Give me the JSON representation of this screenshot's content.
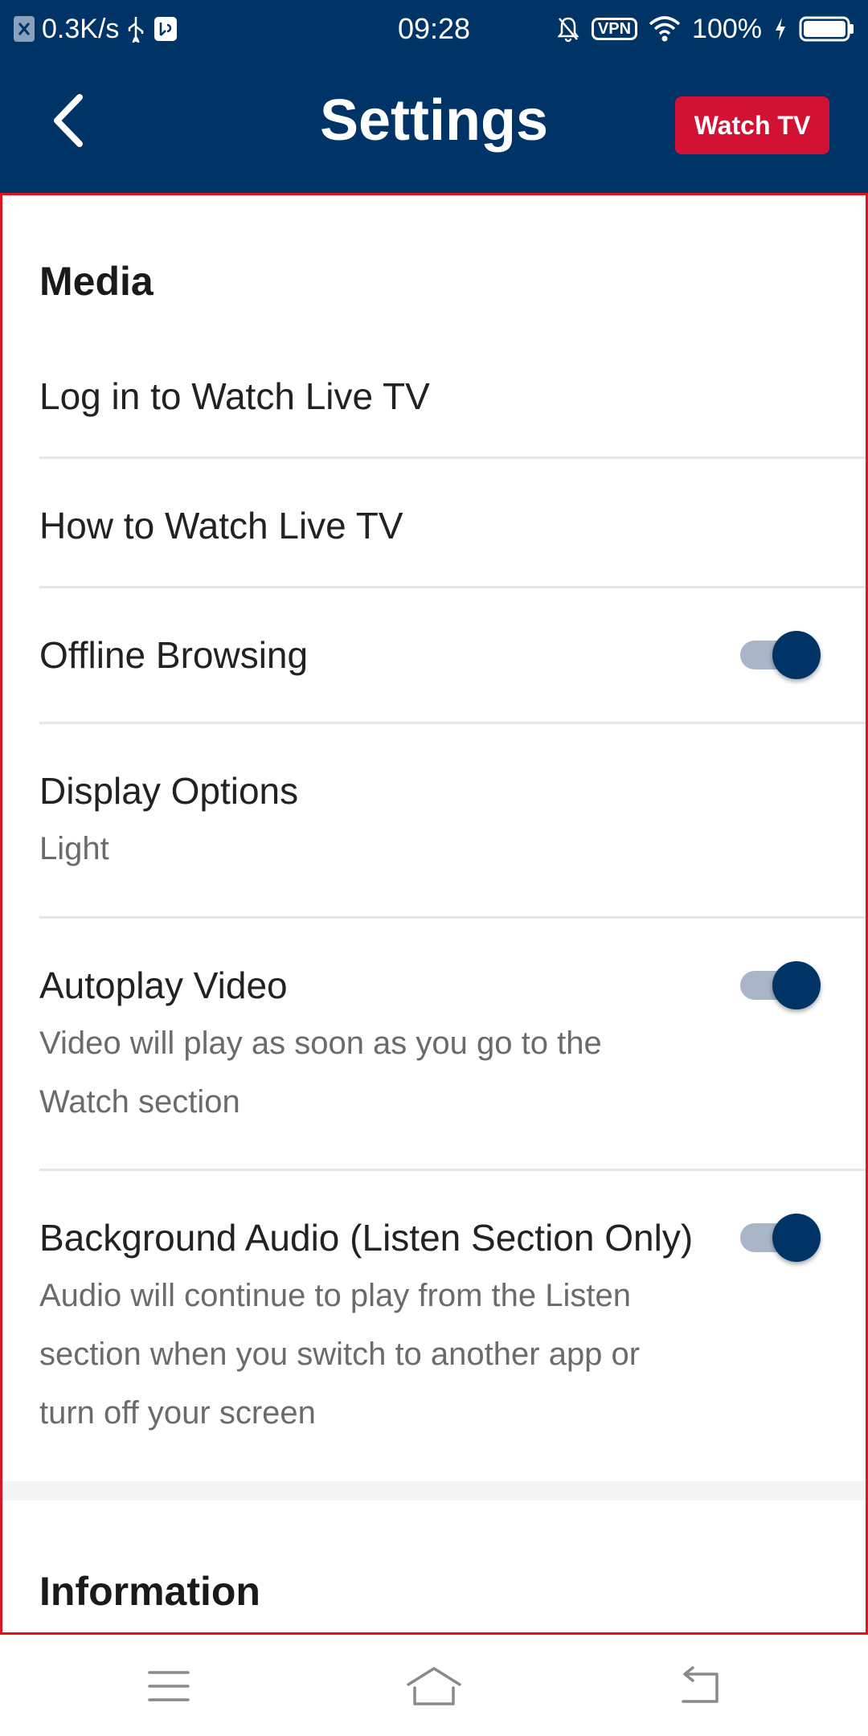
{
  "status_bar": {
    "net_speed": "0.3K/s",
    "time": "09:28",
    "vpn": "VPN",
    "battery": "100%"
  },
  "header": {
    "title": "Settings",
    "watch_tv_label": "Watch TV"
  },
  "sections": {
    "media": {
      "title": "Media",
      "items": [
        {
          "title": "Log in to Watch Live TV"
        },
        {
          "title": "How to Watch Live TV"
        },
        {
          "title": "Offline Browsing",
          "toggle": true
        },
        {
          "title": "Display Options",
          "subtitle": "Light"
        },
        {
          "title": "Autoplay Video",
          "subtitle_line1": "Video will play as soon as you go to the",
          "subtitle_line2": "Watch section",
          "toggle": true
        },
        {
          "title": "Background Audio (Listen Section Only)",
          "subtitle_line1": "Audio will continue to play from the Listen",
          "subtitle_line2": "section when you switch to another app or",
          "subtitle_line3": "turn off your screen",
          "toggle": true
        }
      ]
    },
    "information": {
      "title": "Information"
    }
  },
  "colors": {
    "brand_navy": "#003366",
    "watch_tv_red": "#d31233",
    "toggle_track": "#a8b6c8",
    "outline_red": "#e0121f"
  }
}
